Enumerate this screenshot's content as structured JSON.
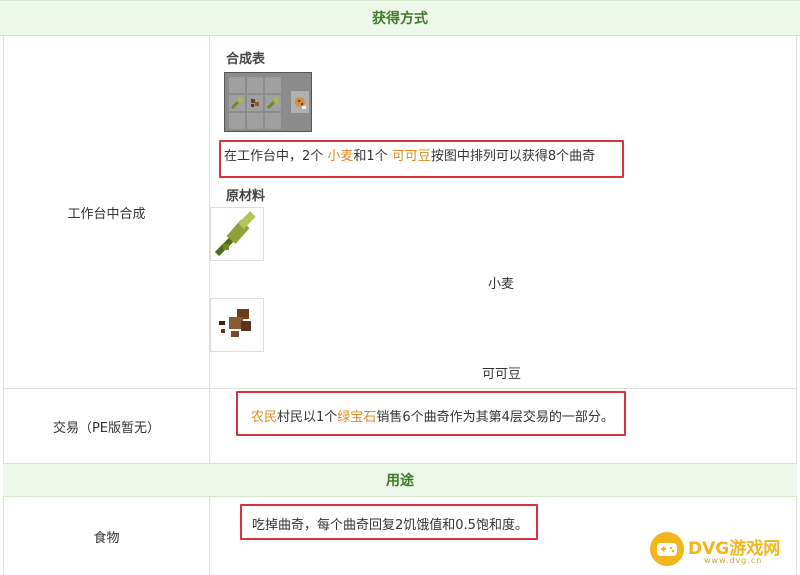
{
  "section_acquire": {
    "title": "获得方式"
  },
  "crafting": {
    "row_label": "工作台中合成",
    "table_title": "合成表",
    "desc_before": "在工作台中，2个 ",
    "ingredient1": "小麦",
    "desc_mid": "和1个 ",
    "ingredient2": "可可豆",
    "desc_after": "按图中排列可以获得8个曲奇",
    "materials_title": "原材料",
    "material1_name": "小麦",
    "material2_name": "可可豆"
  },
  "trade": {
    "row_label": "交易（PE版暂无）",
    "villager": "农民",
    "text1": "村民以1个",
    "emerald": "绿宝石",
    "text2": "销售6个曲奇作为其第4层交易的一部分。"
  },
  "section_use": {
    "title": "用途"
  },
  "food": {
    "row_label": "食物",
    "desc": "吃掉曲奇，每个曲奇回复2饥饿值和0.5饱和度。"
  },
  "watermark": {
    "brand": "DVG游戏网",
    "url": "www.dvg.cn"
  },
  "colors": {
    "header_bg": "#eef8ea",
    "header_text": "#3f7a2c",
    "highlight": "#e08a1e",
    "box": "#d9333f"
  }
}
